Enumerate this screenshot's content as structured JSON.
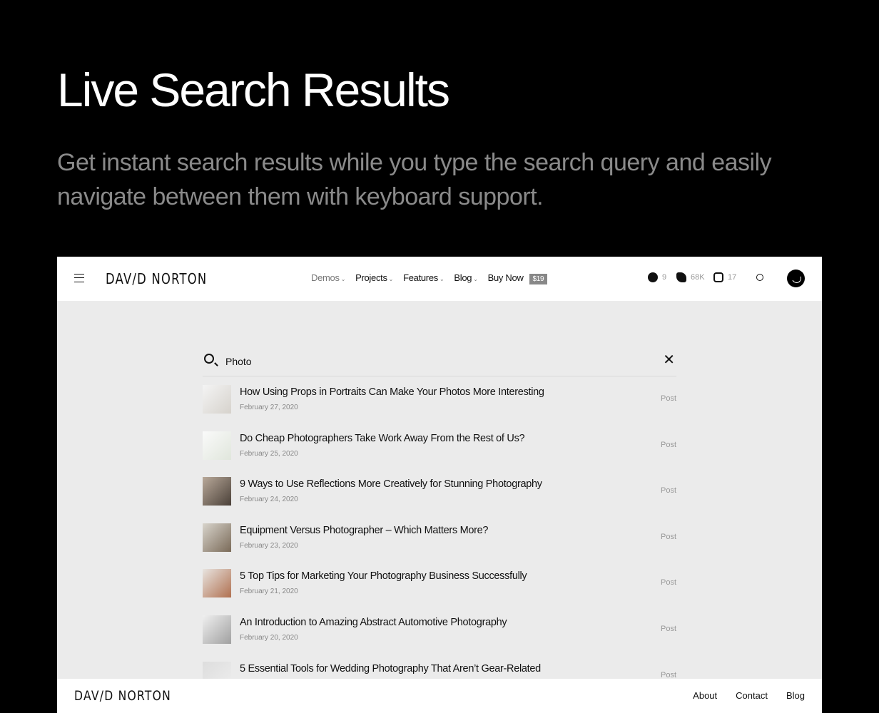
{
  "hero": {
    "title": "Live Search Results",
    "subtitle": "Get instant search results while you type the search query and easily navigate between them with keyboard support."
  },
  "header": {
    "logo": "DAV/D NORTON",
    "nav": [
      {
        "label": "Demos"
      },
      {
        "label": "Projects"
      },
      {
        "label": "Features"
      },
      {
        "label": "Blog"
      }
    ],
    "buy": "Buy Now",
    "price": "$19",
    "social": [
      {
        "icon": "facebook-icon",
        "count": "9"
      },
      {
        "icon": "twitter-icon",
        "count": "68K"
      },
      {
        "icon": "instagram-icon",
        "count": "17"
      }
    ]
  },
  "search": {
    "query": "Photo"
  },
  "results": [
    {
      "title": "How Using Props in Portraits Can Make Your Photos More Interesting",
      "date": "February 27, 2020",
      "type": "Post"
    },
    {
      "title": "Do Cheap Photographers Take Work Away From the Rest of Us?",
      "date": "February 25, 2020",
      "type": "Post"
    },
    {
      "title": "9 Ways to Use Reflections More Creatively for Stunning Photography",
      "date": "February 24, 2020",
      "type": "Post"
    },
    {
      "title": "Equipment Versus Photographer – Which Matters More?",
      "date": "February 23, 2020",
      "type": "Post"
    },
    {
      "title": "5 Top Tips for Marketing Your Photography Business Successfully",
      "date": "February 21, 2020",
      "type": "Post"
    },
    {
      "title": "An Introduction to Amazing Abstract Automotive Photography",
      "date": "February 20, 2020",
      "type": "Post"
    },
    {
      "title": "5 Essential Tools for Wedding Photography That Aren’t Gear-Related",
      "date": "",
      "type": "Post"
    }
  ],
  "footer": {
    "logo": "DAV/D NORTON",
    "links": [
      "About",
      "Contact",
      "Blog"
    ]
  }
}
